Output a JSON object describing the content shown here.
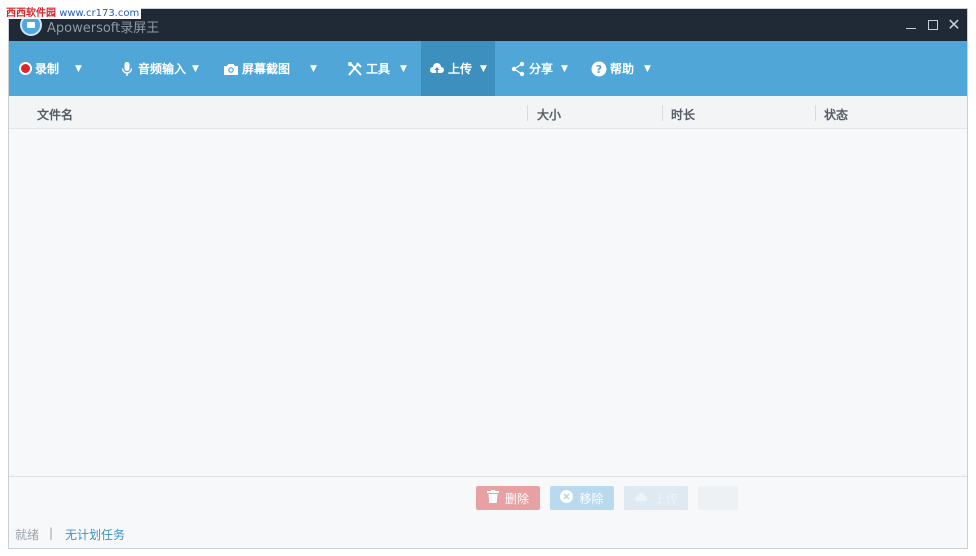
{
  "watermark": {
    "site": "西西软件园",
    "url": "www.cr173.com"
  },
  "window": {
    "title": "Apowersoft录屏王"
  },
  "toolbar": {
    "items": [
      {
        "label": "录制",
        "icon": "record-icon"
      },
      {
        "label": "音频输入",
        "icon": "microphone-icon"
      },
      {
        "label": "屏幕截图",
        "icon": "camera-icon"
      },
      {
        "label": "工具",
        "icon": "tools-icon"
      },
      {
        "label": "上传",
        "icon": "cloud-upload-icon",
        "active": true
      },
      {
        "label": "分享",
        "icon": "share-icon"
      },
      {
        "label": "帮助",
        "icon": "help-icon"
      }
    ]
  },
  "table": {
    "columns": [
      "文件名",
      "大小",
      "时长",
      "状态"
    ],
    "rows": []
  },
  "actions": {
    "delete_label": "删除",
    "remove_label": "移除",
    "upload_label": "上传"
  },
  "status": {
    "ready": "就绪",
    "separator": "|",
    "schedule_link": "无计划任务"
  },
  "colors": {
    "titlebar": "#1f2a36",
    "toolbar": "#4fa6d7",
    "toolbar_active": "#3d8fbe",
    "record_red": "#e02525",
    "link_blue": "#3f91c6"
  }
}
